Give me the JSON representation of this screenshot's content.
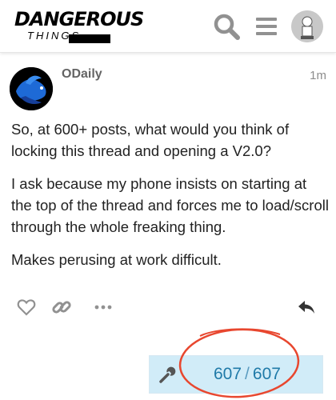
{
  "header": {
    "logo_top": "DANGEROUS",
    "logo_bottom": "THINGS",
    "icons": [
      "search-icon",
      "hamburger-menu-icon",
      "user-avatar"
    ]
  },
  "post": {
    "username": "ODaily",
    "time": "1m",
    "paragraphs": [
      "So, at 600+ posts, what would you think of locking this thread and opening a V2.0?",
      "I ask because my phone insists on starting at the top of the thread and forces me to load/scroll through the whole freaking thing.",
      "Makes perusing at work difficult."
    ],
    "actions": [
      "heart-icon",
      "link-icon",
      "more-icon",
      "reply-icon"
    ]
  },
  "progress": {
    "current": "607",
    "separator": "/",
    "total": "607",
    "fraction": 1.0
  },
  "colors": {
    "accent": "#1f7aa8",
    "progress_bg": "#d1ecf8",
    "annotation_circle": "#e8472f",
    "icon_gray": "#919191"
  }
}
